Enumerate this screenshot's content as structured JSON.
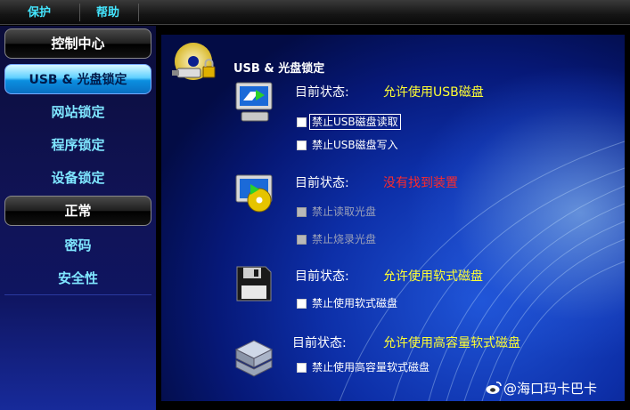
{
  "menu": {
    "protect": "保护",
    "help": "帮助"
  },
  "sidebar": {
    "control_center": "控制中心",
    "items": [
      "USB & 光盘锁定",
      "网站锁定",
      "程序锁定",
      "设备锁定"
    ],
    "normal": "正常",
    "items2": [
      "密码",
      "安全性"
    ]
  },
  "main": {
    "title": "USB & 光盘锁定",
    "status_label": "目前状态:",
    "usb": {
      "status": "允许使用USB磁盘",
      "status_color": "#ffff33",
      "options": [
        "禁止USB磁盘读取",
        "禁止USB磁盘写入"
      ]
    },
    "cd": {
      "status": "没有找到装置",
      "status_color": "#ff2a2a",
      "options": [
        "禁止读取光盘",
        "禁止烧录光盘"
      ]
    },
    "floppy": {
      "status": "允许使用软式磁盘",
      "status_color": "#ffff33",
      "options": [
        "禁止使用软式磁盘"
      ]
    },
    "hd_floppy": {
      "status": "允许使用高容量软式磁盘",
      "status_color": "#ffff33",
      "options": [
        "禁止使用高容量软式磁盘"
      ]
    }
  },
  "watermark": "@海口玛卡巴卡",
  "icons": [
    "usb-cd-lock-icon",
    "usb-monitor-icon",
    "cd-monitor-icon",
    "floppy-disk-icon",
    "hd-floppy-drive-icon",
    "weibo-logo-icon"
  ]
}
